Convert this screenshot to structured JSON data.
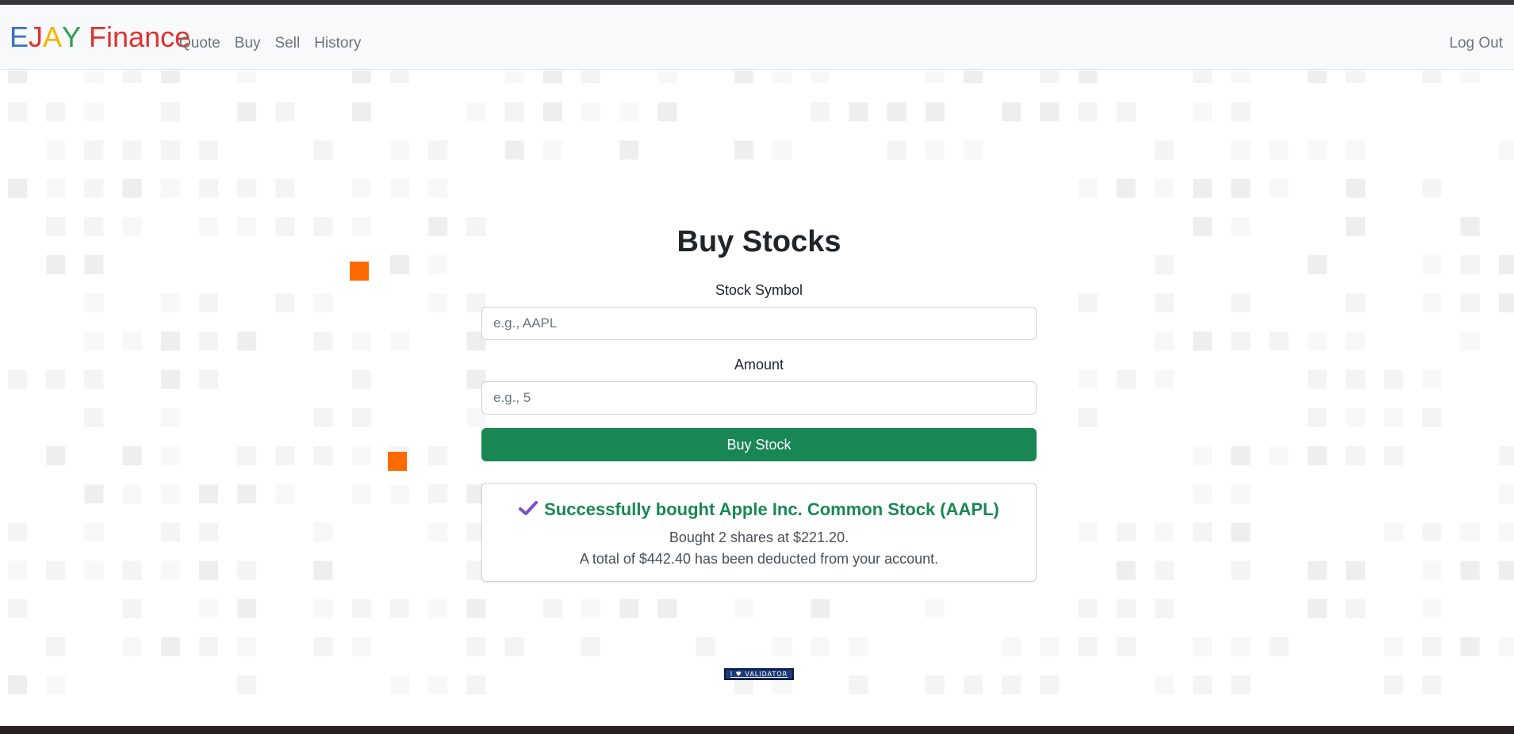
{
  "navbar": {
    "brand": [
      {
        "text": "E",
        "color": "#3b6fc9"
      },
      {
        "text": "J",
        "color": "#e0312f"
      },
      {
        "text": "A",
        "color": "#f5b400"
      },
      {
        "text": "Y",
        "color": "#2f9d4f"
      },
      {
        "text": " Finance",
        "color": "#e0312f"
      }
    ],
    "links": [
      "Quote",
      "Buy",
      "Sell",
      "History"
    ],
    "logout": "Log Out"
  },
  "form": {
    "title": "Buy Stocks",
    "symbol_label": "Stock Symbol",
    "symbol_placeholder": "e.g., AAPL",
    "amount_label": "Amount",
    "amount_placeholder": "e.g., 5",
    "submit_label": "Buy Stock"
  },
  "alert": {
    "icon": "check-icon",
    "heading": "Successfully bought Apple Inc. Common Stock (AAPL)",
    "line1": "Bought 2 shares at $221.20.",
    "line2": "A total of $442.40 has been deducted from your account."
  },
  "footer": {
    "badge": "I ♥ VALIDATOR"
  },
  "colors": {
    "accent_green": "#198754",
    "highlight_orange": "#ff6a00",
    "check_purple": "#7b4fc9"
  }
}
